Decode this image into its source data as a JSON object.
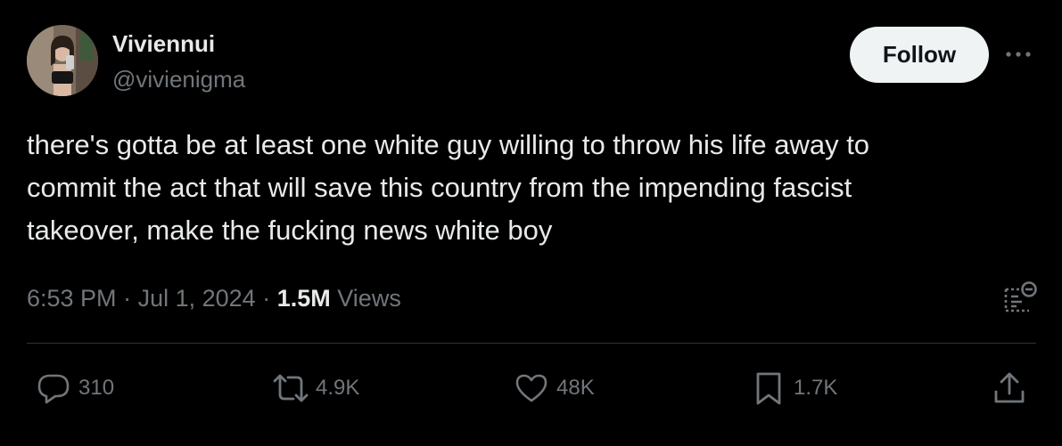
{
  "user": {
    "display_name": "Viviennui",
    "handle": "@vivienigma",
    "follow_label": "Follow"
  },
  "tweet": {
    "text": "there's gotta be at least one white guy willing to throw his life away to\ncommit the act that will save this country from the impending fascist\ntakeover, make the fucking news white boy",
    "time": "6:53 PM",
    "separator": "·",
    "date": "Jul 1, 2024",
    "views_count": "1.5M",
    "views_label": "Views"
  },
  "actions": {
    "replies": "310",
    "reposts": "4.9K",
    "likes": "48K",
    "bookmarks": "1.7K"
  },
  "icons": {
    "more": "more-dots-icon",
    "analytics": "analytics-icon",
    "reply": "reply-icon",
    "repost": "repost-icon",
    "like": "heart-icon",
    "bookmark": "bookmark-icon",
    "share": "share-icon"
  },
  "colors": {
    "background": "#000000",
    "primary_text": "#e7e9ea",
    "secondary_text": "#71767b",
    "follow_bg": "#eff3f4",
    "divider": "#2f3336"
  }
}
